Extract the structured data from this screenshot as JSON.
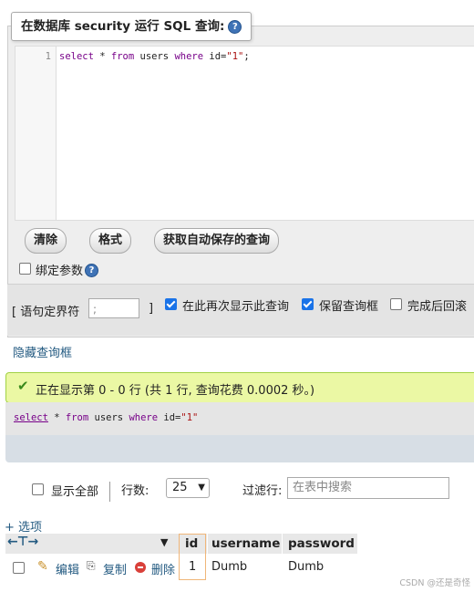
{
  "query_panel": {
    "legend": "在数据库 security 运行 SQL 查询:",
    "line_number": "1",
    "query_parts": [
      "select",
      " * ",
      "from",
      " users ",
      "where",
      " id=",
      "\"1\"",
      ";"
    ],
    "buttons": {
      "clear": "清除",
      "format": "格式",
      "saved_query": "获取自动保存的查询"
    },
    "bind_params_label": "绑定参数"
  },
  "options_bar": {
    "delimiter_label": "[ 语句定界符",
    "delimiter_value": ";",
    "bracket_close": "]",
    "show_again_label": "在此再次显示此查询",
    "show_again_checked": true,
    "keep_box_label": "保留查询框",
    "keep_box_checked": true,
    "rollback_label": "完成后回滚",
    "rollback_checked": false
  },
  "hide_query_link": "隐藏查询框",
  "result": {
    "success_message": "正在显示第 0 - 0 行 (共 1 行, 查询花费 0.0002 秒。)",
    "sql_parts": [
      "select",
      " * ",
      "from",
      " users ",
      "where",
      " id=",
      "\"1\""
    ]
  },
  "pagination": {
    "show_all_label": "显示全部",
    "rows_label": "行数:",
    "rows_value": "25",
    "filter_label": "过滤行:",
    "filter_placeholder": "在表中搜索"
  },
  "options_link": "+ 选项",
  "table": {
    "columns": [
      "id",
      "username",
      "password"
    ],
    "rows": [
      {
        "edit": "编辑",
        "copy": "复制",
        "delete": "删除",
        "id": "1",
        "username": "Dumb",
        "password": "Dumb"
      }
    ]
  },
  "watermark": "CSDN @还是奇怪",
  "colors": {
    "accent": "#235a81",
    "success_bg": "#ebf8a4",
    "checkbox": "#1a73e8"
  }
}
